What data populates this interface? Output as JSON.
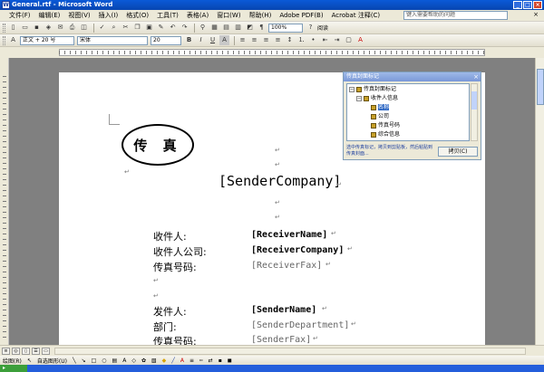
{
  "window": {
    "title": "General.rtf - Microsoft Word",
    "app_icon": "W"
  },
  "menu": {
    "items": [
      "文件(F)",
      "编辑(E)",
      "视图(V)",
      "插入(I)",
      "格式(O)",
      "工具(T)",
      "表格(A)",
      "窗口(W)",
      "帮助(H)",
      "Adobe PDF(B)",
      "Acrobat 注释(C)"
    ],
    "help_placeholder": "键入需要帮助的问题"
  },
  "toolbar": {
    "zoom": "100%",
    "reading_label": "阅读",
    "style": "正文 + 20 号",
    "font": "宋体",
    "size": "20",
    "bold": "B",
    "italic": "I",
    "underline": "U",
    "char_shading": "A"
  },
  "xml_pane": {
    "title": "传真封面标记",
    "tree": [
      {
        "label": "传真封面标记",
        "level": 0
      },
      {
        "label": "收件人信息",
        "level": 1
      },
      {
        "label": "名称",
        "level": 2,
        "selected": true
      },
      {
        "label": "公司",
        "level": 2
      },
      {
        "label": "传真号码",
        "level": 2
      },
      {
        "label": "综合信息",
        "level": 2
      }
    ],
    "hint": "选中传真标记，拷贝到剪贴板，然后粘贴到传真封面...",
    "copy_button": "拷贝(C)"
  },
  "document": {
    "fax_heading": "传 真",
    "sender_company": "[SenderCompany]",
    "receiver_fields": [
      {
        "label": "收件人:",
        "value": "[ReceiverName]"
      },
      {
        "label": "收件人公司:",
        "value": "[ReceiverCompany]"
      },
      {
        "label": "传真号码:",
        "value": "[ReceiverFax]"
      }
    ],
    "sender_fields": [
      {
        "label": "发件人:",
        "value": "[SenderName]"
      },
      {
        "label": "部门:",
        "value": "[SenderDepartment]"
      },
      {
        "label": "传真号码:",
        "value": "[SenderFax]"
      }
    ],
    "paragraph_mark": "↵"
  },
  "drawing_toolbar": {
    "draw_label": "绘图(R)",
    "autoshapes_label": "自选图形(U)"
  }
}
